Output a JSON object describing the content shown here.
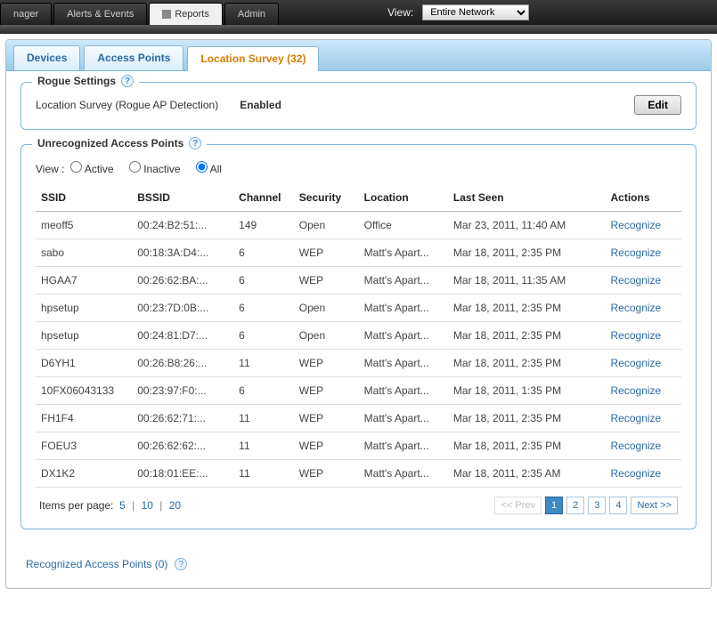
{
  "topnav": {
    "tabs": [
      "nager",
      "Alerts & Events",
      "Reports",
      "Admin"
    ],
    "active_index": 2,
    "view_label": "View:",
    "view_select": "Entire Network"
  },
  "subtabs": {
    "items": [
      "Devices",
      "Access Points",
      "Location Survey (32)"
    ],
    "active_index": 2
  },
  "rogue": {
    "legend": "Rogue Settings",
    "label": "Location Survey (Rogue AP Detection)",
    "status": "Enabled",
    "edit_label": "Edit"
  },
  "aps": {
    "legend": "Unrecognized Access Points",
    "view_label": "View :",
    "radios": {
      "active": "Active",
      "inactive": "Inactive",
      "all": "All"
    },
    "selected_radio": "all",
    "columns": {
      "ssid": "SSID",
      "bssid": "BSSID",
      "channel": "Channel",
      "security": "Security",
      "location": "Location",
      "last_seen": "Last Seen",
      "actions": "Actions"
    },
    "action_label": "Recognize",
    "rows": [
      {
        "ssid": "meoff5",
        "bssid": "00:24:B2:51:...",
        "channel": "149",
        "security": "Open",
        "location": "Office",
        "last_seen": "Mar 23, 2011, 11:40 AM"
      },
      {
        "ssid": "sabo",
        "bssid": "00:18:3A:D4:...",
        "channel": "6",
        "security": "WEP",
        "location": "Matt's Apart...",
        "last_seen": "Mar 18, 2011, 2:35 PM"
      },
      {
        "ssid": "HGAA7",
        "bssid": "00:26:62:BA:...",
        "channel": "6",
        "security": "WEP",
        "location": "Matt's Apart...",
        "last_seen": "Mar 18, 2011, 11:35 AM"
      },
      {
        "ssid": "hpsetup",
        "bssid": "00:23:7D:0B:...",
        "channel": "6",
        "security": "Open",
        "location": "Matt's Apart...",
        "last_seen": "Mar 18, 2011, 2:35 PM"
      },
      {
        "ssid": "hpsetup",
        "bssid": "00:24:81:D7:...",
        "channel": "6",
        "security": "Open",
        "location": "Matt's Apart...",
        "last_seen": "Mar 18, 2011, 2:35 PM"
      },
      {
        "ssid": "D6YH1",
        "bssid": "00:26:B8:26:...",
        "channel": "11",
        "security": "WEP",
        "location": "Matt's Apart...",
        "last_seen": "Mar 18, 2011, 2:35 PM"
      },
      {
        "ssid": "10FX06043133",
        "bssid": "00:23:97:F0:...",
        "channel": "6",
        "security": "WEP",
        "location": "Matt's Apart...",
        "last_seen": "Mar 18, 2011, 1:35 PM"
      },
      {
        "ssid": "FH1F4",
        "bssid": "00:26:62:71:...",
        "channel": "11",
        "security": "WEP",
        "location": "Matt's Apart...",
        "last_seen": "Mar 18, 2011, 2:35 PM"
      },
      {
        "ssid": "FOEU3",
        "bssid": "00:26:62:62:...",
        "channel": "11",
        "security": "WEP",
        "location": "Matt's Apart...",
        "last_seen": "Mar 18, 2011, 2:35 PM"
      },
      {
        "ssid": "DX1K2",
        "bssid": "00:18:01:EE:...",
        "channel": "11",
        "security": "WEP",
        "location": "Matt's Apart...",
        "last_seen": "Mar 18, 2011, 2:35 AM"
      }
    ],
    "perpage": {
      "label": "Items per page:",
      "options": [
        "5",
        "10",
        "20"
      ],
      "separator": "|"
    },
    "pager": {
      "prev": "<< Prev",
      "pages": [
        "1",
        "2",
        "3",
        "4"
      ],
      "active": 0,
      "next": "Next >>"
    }
  },
  "recognized": {
    "label": "Recognized Access Points (0)"
  }
}
